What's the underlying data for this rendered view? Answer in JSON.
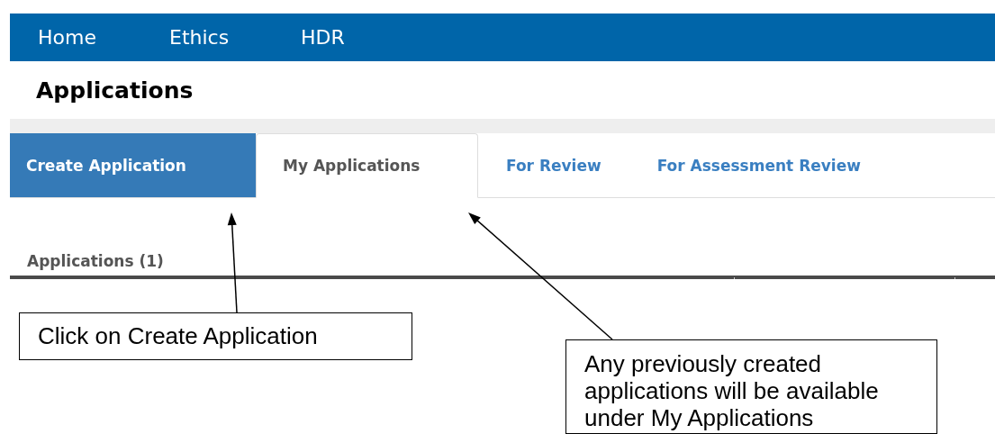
{
  "nav": {
    "items": [
      {
        "label": "Home"
      },
      {
        "label": "Ethics"
      },
      {
        "label": "HDR"
      }
    ]
  },
  "page_title": "Applications",
  "tabs": [
    {
      "label": "Create Application",
      "kind": "action",
      "selected": false
    },
    {
      "label": "My Applications",
      "kind": "tab",
      "selected": true
    },
    {
      "label": "For Review",
      "kind": "tab",
      "selected": false
    },
    {
      "label": "For Assessment Review",
      "kind": "tab",
      "selected": false
    }
  ],
  "section_heading": "Applications (1)",
  "callouts": [
    {
      "text": "Click on Create Application"
    },
    {
      "text": "Any previously created applications will be available under My Applications"
    }
  ]
}
